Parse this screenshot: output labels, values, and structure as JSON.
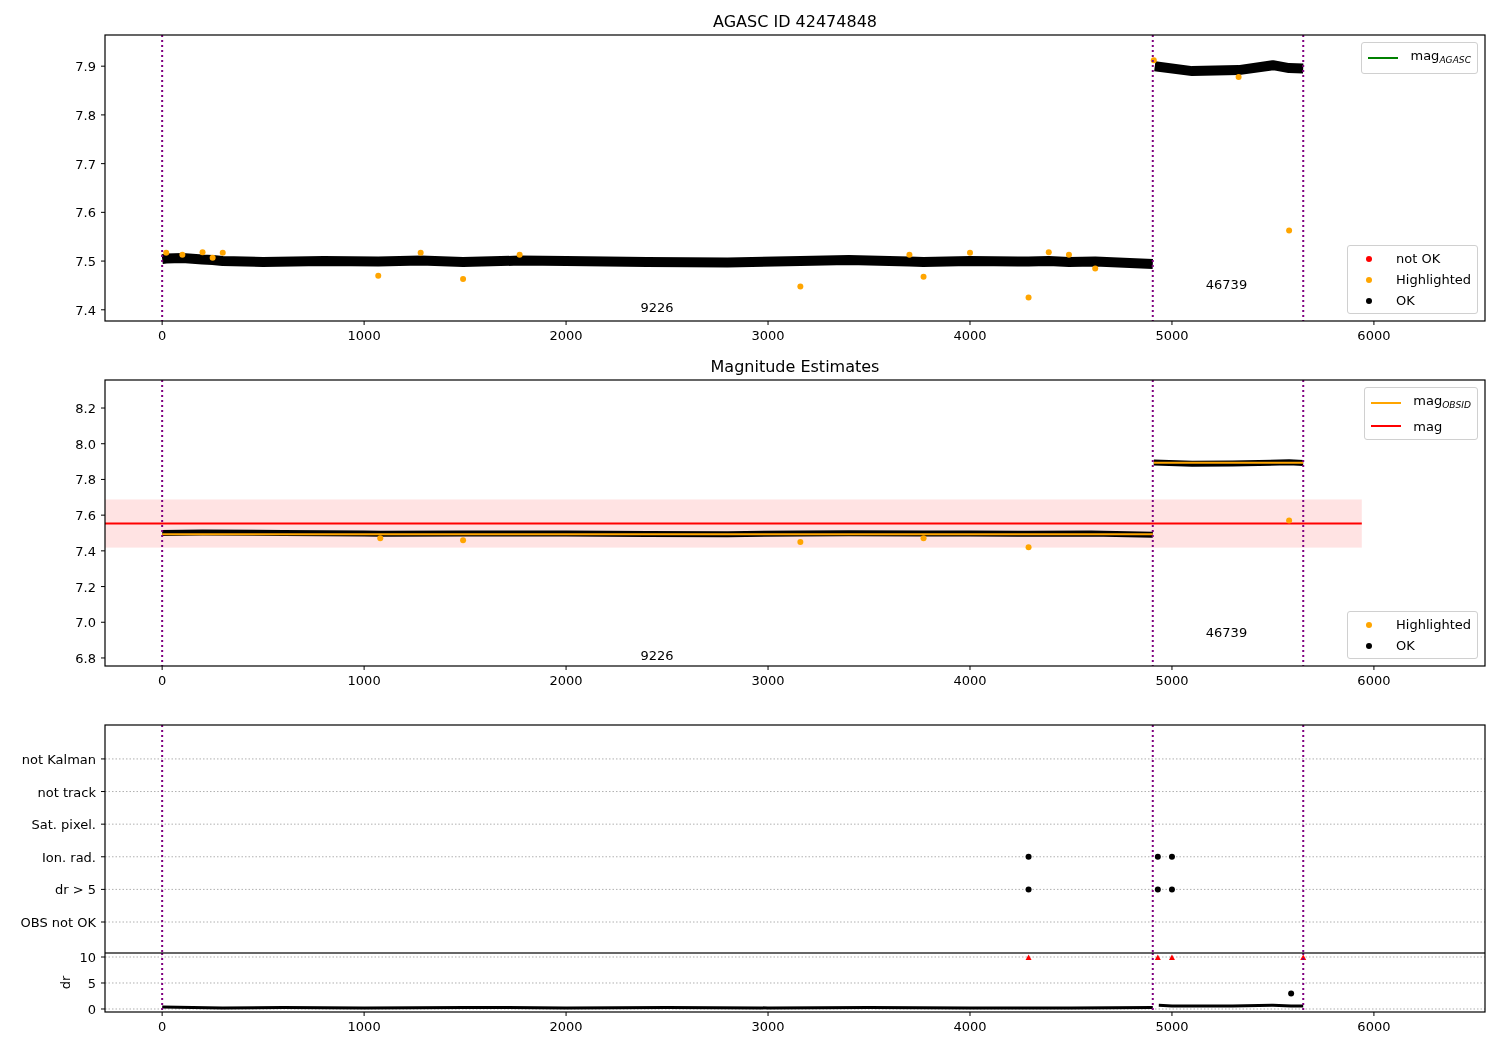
{
  "charts": [
    {
      "chart_data": {
        "type": "scatter",
        "title": "AGASC ID 42474848",
        "x": [
          0,
          20,
          100,
          200,
          250,
          300,
          500,
          800,
          1070,
          1280,
          1490,
          1770,
          2000,
          2400,
          2800,
          3160,
          3400,
          3700,
          3770,
          4000,
          4290,
          4390,
          4490,
          4620,
          4905,
          4910,
          4915,
          5100,
          5330,
          5500,
          5580,
          5650
        ],
        "xlim": [
          -283,
          6550
        ],
        "ylim": [
          7.377,
          7.964
        ],
        "xticks": [
          0,
          1000,
          2000,
          3000,
          4000,
          5000,
          6000
        ],
        "yticks": [
          7.4,
          7.5,
          7.6,
          7.7,
          7.8,
          7.9
        ],
        "series": [
          {
            "type": "line",
            "color": "#000000",
            "values": [
              7.504,
              7.505,
              7.506,
              7.503,
              7.502,
              7.5,
              7.498,
              7.5,
              7.499,
              7.501,
              7.498,
              7.501,
              7.5,
              7.498,
              7.497,
              7.5,
              7.502,
              7.499,
              7.498,
              7.5,
              7.499,
              7.5,
              7.498,
              7.499,
              7.494,
              null,
              7.9,
              7.89,
              7.892,
              7.902,
              7.896,
              7.895
            ]
          },
          {
            "type": "scatter",
            "color": "#ffa500",
            "values": [
              null,
              7.517,
              7.513,
              7.518,
              7.507,
              7.517,
              null,
              null,
              7.47,
              7.517,
              7.463,
              7.513,
              null,
              null,
              null,
              7.448,
              null,
              7.513,
              7.468,
              7.517,
              7.425,
              7.518,
              7.513,
              7.485,
              null,
              7.912,
              null,
              null,
              7.878,
              null,
              7.563,
              null
            ]
          }
        ],
        "ref_lines": [
          {
            "axis": "x",
            "value": 0,
            "color": "#800080"
          },
          {
            "axis": "x",
            "value": 4905,
            "color": "#800080"
          },
          {
            "axis": "x",
            "value": 5650,
            "color": "#800080"
          }
        ],
        "annotations": [
          "9226",
          "46739"
        ]
      },
      "legends": [
        {
          "items": [
            {
              "label": "mag$_{AGASC}$",
              "kind": "line",
              "color": "#008000"
            }
          ]
        },
        {
          "items": [
            {
              "label": "not OK",
              "kind": "dot",
              "color": "#ff0000"
            },
            {
              "label": "Highlighted",
              "kind": "dot",
              "color": "#ffa500"
            },
            {
              "label": "OK",
              "kind": "dot",
              "color": "#000000"
            }
          ]
        }
      ]
    },
    {
      "chart_data": {
        "type": "scatter",
        "title": "Magnitude Estimates",
        "x": [
          -283,
          0,
          200,
          600,
          1000,
          1080,
          1490,
          2000,
          2400,
          2800,
          3160,
          3400,
          3770,
          4000,
          4290,
          4600,
          4905,
          4907,
          4910,
          5100,
          5300,
          5580,
          5650,
          5940
        ],
        "xlim": [
          -283,
          6550
        ],
        "ylim": [
          6.755,
          8.357
        ],
        "xticks": [
          0,
          1000,
          2000,
          3000,
          4000,
          5000,
          6000
        ],
        "yticks": [
          {
            "value": 6.8,
            "label": "6.8"
          },
          {
            "value": 7.0,
            "label": "7.0"
          },
          {
            "value": 7.2,
            "label": "7.2"
          },
          {
            "value": 7.4,
            "label": "7.4"
          },
          {
            "value": 7.6,
            "label": "7.6"
          },
          {
            "value": 7.8,
            "label": "7.8"
          },
          {
            "value": 8.0,
            "label": "8.0"
          },
          {
            "value": 8.2,
            "label": "8.2"
          }
        ],
        "series": [
          {
            "type": "line",
            "color": "#000000",
            "values": [
              null,
              7.5,
              7.503,
              7.5,
              7.497,
              7.496,
              7.497,
              7.497,
              7.495,
              7.493,
              7.497,
              7.499,
              7.497,
              7.497,
              7.496,
              7.497,
              7.49,
              null,
              7.895,
              7.888,
              7.89,
              7.896,
              7.892,
              null
            ]
          },
          {
            "type": "line",
            "color": "#ffa500",
            "values": [
              null,
              7.493,
              7.493,
              7.493,
              7.493,
              7.493,
              7.493,
              7.493,
              7.493,
              7.493,
              7.493,
              7.493,
              7.493,
              7.493,
              7.493,
              7.493,
              7.493,
              null,
              7.893,
              7.893,
              7.893,
              7.893,
              7.893,
              null
            ]
          },
          {
            "type": "line",
            "color": "#ff0000",
            "values": [
              7.553,
              7.553,
              7.553,
              7.553,
              7.553,
              7.553,
              7.553,
              7.553,
              7.553,
              7.553,
              7.553,
              7.553,
              7.553,
              7.553,
              7.553,
              7.553,
              7.553,
              7.553,
              7.553,
              7.553,
              7.553,
              7.553,
              7.553,
              7.553
            ]
          },
          {
            "type": "scatter",
            "color": "#ffa500",
            "values": [
              null,
              null,
              null,
              null,
              null,
              7.47,
              7.46,
              null,
              null,
              null,
              7.45,
              null,
              7.47,
              null,
              7.42,
              null,
              null,
              null,
              null,
              null,
              null,
              7.57,
              null,
              null
            ]
          }
        ],
        "bands": [
          {
            "axis": "y",
            "from": 7.418,
            "to": 7.688,
            "color": "#ff0000"
          }
        ],
        "ref_lines": [
          {
            "axis": "x",
            "value": 0,
            "color": "#800080"
          },
          {
            "axis": "x",
            "value": 4905,
            "color": "#800080"
          },
          {
            "axis": "x",
            "value": 5650,
            "color": "#800080"
          }
        ],
        "annotations": [
          "9226",
          "46739"
        ]
      },
      "legends": [
        {
          "items": [
            {
              "label": "mag$_{OBSID}$",
              "kind": "line",
              "color": "#ffa500"
            },
            {
              "label": "mag",
              "kind": "line",
              "color": "#ff0000"
            }
          ]
        },
        {
          "items": [
            {
              "label": "Highlighted",
              "kind": "dot",
              "color": "#ffa500"
            },
            {
              "label": "OK",
              "kind": "dot",
              "color": "#000000"
            }
          ]
        }
      ]
    },
    {
      "chart_data": {
        "type": "scatter",
        "orientation": "horizontal",
        "grid": true,
        "categories": [
          "not Kalman",
          "not track",
          "Sat. pixel.",
          "Ion. rad.",
          "dr > 5",
          "OBS not OK"
        ],
        "xlim": [
          -283,
          6550
        ],
        "series": [
          {
            "color": "#000000",
            "values": [
              null,
              null,
              null,
              4290,
              4290,
              null
            ]
          },
          {
            "color": "#000000",
            "values": [
              null,
              null,
              null,
              4930,
              4930,
              null
            ]
          },
          {
            "color": "#000000",
            "values": [
              null,
              null,
              null,
              5000,
              5000,
              null
            ]
          }
        ],
        "ref_lines": [
          {
            "axis": "x",
            "value": 0,
            "color": "#800080"
          },
          {
            "axis": "x",
            "value": 4905,
            "color": "#800080"
          },
          {
            "axis": "x",
            "value": 5650,
            "color": "#800080"
          }
        ]
      }
    },
    {
      "chart_data": {
        "type": "scatter",
        "ylabel": "dr",
        "grid": true,
        "x": [
          0,
          300,
          600,
          1000,
          1500,
          2000,
          2500,
          3000,
          3500,
          4000,
          4290,
          4500,
          4905,
          4930,
          4935,
          5000,
          5100,
          5300,
          5500,
          5590,
          5650
        ],
        "xlim": [
          -283,
          6550
        ],
        "ylim": [
          -0.58,
          10.77
        ],
        "xticks": [
          0,
          1000,
          2000,
          3000,
          4000,
          5000,
          6000
        ],
        "yticks": [
          0,
          5,
          10
        ],
        "series": [
          {
            "type": "line",
            "color": "#000000",
            "values": [
              0.4,
              0.2,
              0.3,
              0.2,
              0.3,
              0.2,
              0.3,
              0.2,
              0.3,
              0.2,
              0.2,
              0.2,
              0.3,
              null,
              0.7,
              0.6,
              0.6,
              0.6,
              0.7,
              0.6,
              0.6
            ]
          },
          {
            "type": "scatter",
            "color": "#000000",
            "values": [
              null,
              null,
              null,
              null,
              null,
              null,
              null,
              null,
              null,
              null,
              null,
              null,
              null,
              null,
              null,
              null,
              null,
              null,
              null,
              3.0,
              null
            ]
          },
          {
            "type": "scatter",
            "marker": "triangle",
            "color": "#ff0000",
            "values": [
              null,
              null,
              null,
              null,
              null,
              null,
              null,
              null,
              null,
              null,
              9.9,
              null,
              null,
              9.9,
              null,
              9.9,
              null,
              null,
              null,
              null,
              9.9
            ]
          }
        ],
        "ref_lines": [
          {
            "axis": "x",
            "value": 0,
            "color": "#800080"
          },
          {
            "axis": "x",
            "value": 4905,
            "color": "#800080"
          },
          {
            "axis": "x",
            "value": 5650,
            "color": "#800080"
          }
        ]
      }
    }
  ]
}
